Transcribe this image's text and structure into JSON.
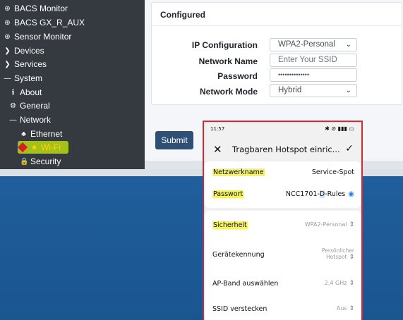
{
  "sidebar": {
    "items": [
      {
        "label": "BACS Monitor",
        "icon": "dashboard-icon",
        "glyph": "⊛"
      },
      {
        "label": "BACS GX_R_AUX",
        "icon": "dashboard-icon",
        "glyph": "⊛"
      },
      {
        "label": "Sensor Monitor",
        "icon": "dashboard-icon",
        "glyph": "⊛"
      },
      {
        "label": "Devices",
        "icon": "chevron-right-icon",
        "glyph": "❯"
      },
      {
        "label": "Services",
        "icon": "chevron-right-icon",
        "glyph": "❯"
      },
      {
        "label": "System",
        "icon": "minus-icon",
        "glyph": "—"
      },
      {
        "label": "About",
        "icon": "info-circle-icon",
        "glyph": "ℹ"
      },
      {
        "label": "General",
        "icon": "cogs-icon",
        "glyph": "⚙"
      },
      {
        "label": "Network",
        "icon": "minus-icon",
        "glyph": "—"
      },
      {
        "label": "Ethernet",
        "icon": "network-tree-icon",
        "glyph": "♣"
      },
      {
        "label": "Wi-Fi",
        "icon": "network-tree-icon",
        "glyph": "♣"
      },
      {
        "label": "Security",
        "icon": "lock-icon",
        "glyph": "🔒"
      }
    ]
  },
  "card": {
    "title": "Configured",
    "fields": {
      "ip_config": {
        "label": "IP Configuration",
        "value": "WPA2-Personal"
      },
      "network_name": {
        "label": "Network Name",
        "placeholder": "Enter Your SSID"
      },
      "password": {
        "label": "Password",
        "value": "••••••••••••••"
      },
      "network_mode": {
        "label": "Network Mode",
        "value": "Hybrid"
      }
    }
  },
  "submit_label": "Submit",
  "phone": {
    "time": "11:57",
    "status_icons": "✱ ⊘ ▮▮▮ ▭",
    "title": "Tragbaren Hotspot einric...",
    "rows": {
      "ssid": {
        "label": "Netzwerkname",
        "value": "Service-Spot"
      },
      "password": {
        "label": "Passwort",
        "value_a": "NCC1701-",
        "value_b": "D",
        "value_c": "-Rules"
      },
      "security": {
        "label": "Sicherheit",
        "value": "WPA2-Personal"
      },
      "device_id": {
        "label": "Gerätekennung",
        "value_1": "Persönlicher",
        "value_2": "Hotspot"
      },
      "ap_band": {
        "label": "AP-Band auswählen",
        "value": "2,4 GHz"
      },
      "hide_ssid": {
        "label": "SSID verstecken",
        "value": "Aus"
      }
    }
  },
  "colors": {
    "sidebar_bg": "#343a40",
    "submit_bg": "#2f4f74",
    "highlight_yellow": "#f4f26a",
    "frame_red": "#d8282d"
  }
}
